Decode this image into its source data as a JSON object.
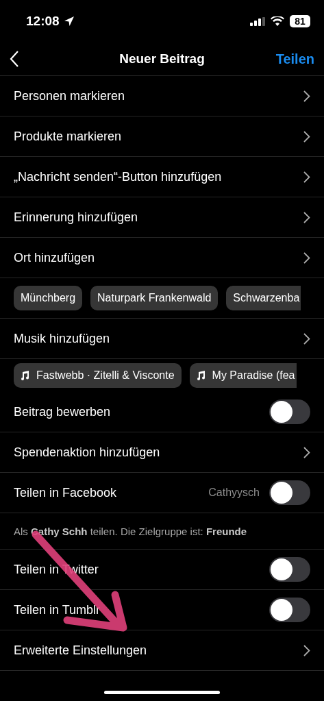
{
  "status_bar": {
    "time": "12:08",
    "battery": "81"
  },
  "header": {
    "title": "Neuer Beitrag",
    "action": "Teilen"
  },
  "rows": [
    {
      "kind": "link",
      "label": "Personen markieren"
    },
    {
      "kind": "link",
      "label": "Produkte markieren"
    },
    {
      "kind": "link",
      "label": "„Nachricht senden“-Button hinzufügen"
    },
    {
      "kind": "link",
      "label": "Erinnerung hinzufügen"
    },
    {
      "kind": "link",
      "label": "Ort hinzufügen"
    },
    {
      "kind": "chips",
      "chips": [
        {
          "label": "Münchberg"
        },
        {
          "label": "Naturpark Frankenwald"
        },
        {
          "label": "Schwarzenba"
        }
      ]
    },
    {
      "kind": "link",
      "label": "Musik hinzufügen"
    },
    {
      "kind": "music",
      "chips": [
        {
          "label": "Fastwebb · Zitelli & Visconte"
        },
        {
          "label": "My Paradise (fea"
        }
      ]
    },
    {
      "kind": "toggle",
      "label": "Beitrag bewerben",
      "on": false
    },
    {
      "kind": "link",
      "label": "Spendenaktion hinzufügen"
    },
    {
      "kind": "toggle",
      "label": "Teilen in Facebook",
      "account": "Cathyysch",
      "on": false
    },
    {
      "kind": "caption",
      "text": "Als **Cathy Schh** teilen. Die Zielgruppe ist: **Freunde**"
    },
    {
      "kind": "toggle",
      "label": "Teilen in Twitter",
      "on": false
    },
    {
      "kind": "toggle",
      "label": "Teilen in Tumblr",
      "on": false
    },
    {
      "kind": "link",
      "label": "Erweiterte Einstellungen"
    }
  ]
}
